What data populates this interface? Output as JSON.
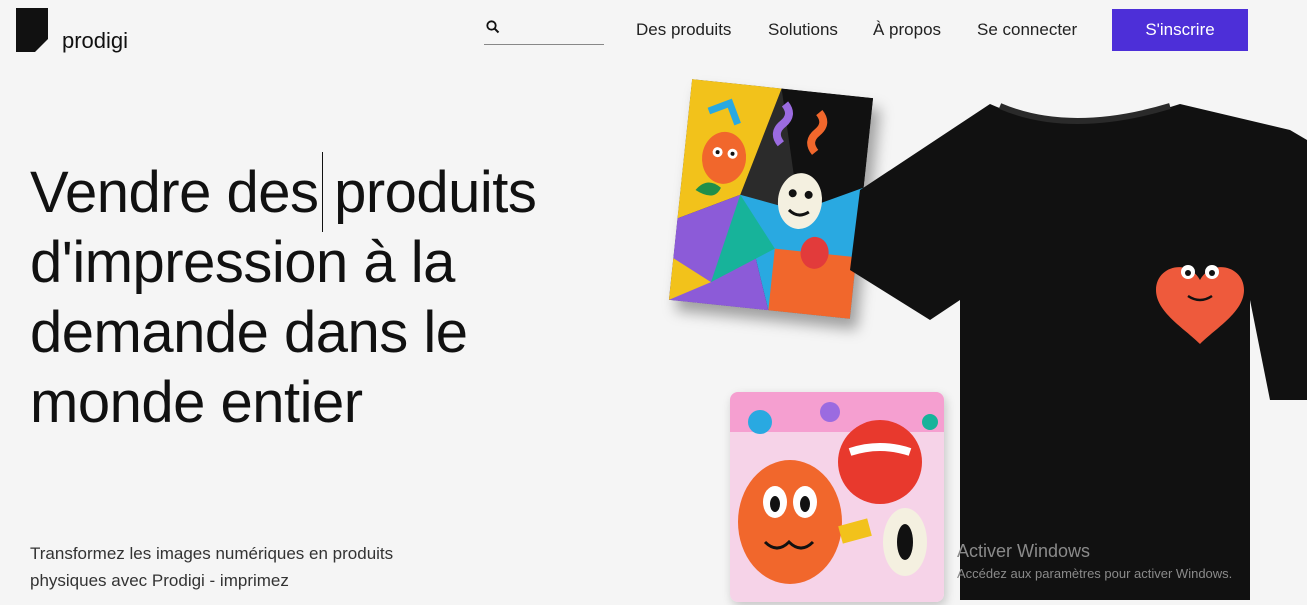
{
  "brand": {
    "name": "prodigi"
  },
  "search": {
    "placeholder": ""
  },
  "nav": {
    "items": [
      {
        "label": "Des produits"
      },
      {
        "label": "Solutions"
      },
      {
        "label": "À propos"
      },
      {
        "label": "Se connecter"
      }
    ],
    "signup_label": "S'inscrire"
  },
  "hero": {
    "headline": "Vendre des produits d'impression à la demande dans le monde entier",
    "subtext": "Transformez les images numériques en produits physiques avec Prodigi - imprimez"
  },
  "colors": {
    "accent": "#4d2fd8",
    "background": "#f5f5f5",
    "tshirt": "#111111",
    "heart": "#ee5a3c"
  },
  "icons": {
    "search": "search-icon"
  },
  "watermark": {
    "title": "Activer Windows",
    "subtitle": "Accédez aux paramètres pour activer Windows."
  }
}
